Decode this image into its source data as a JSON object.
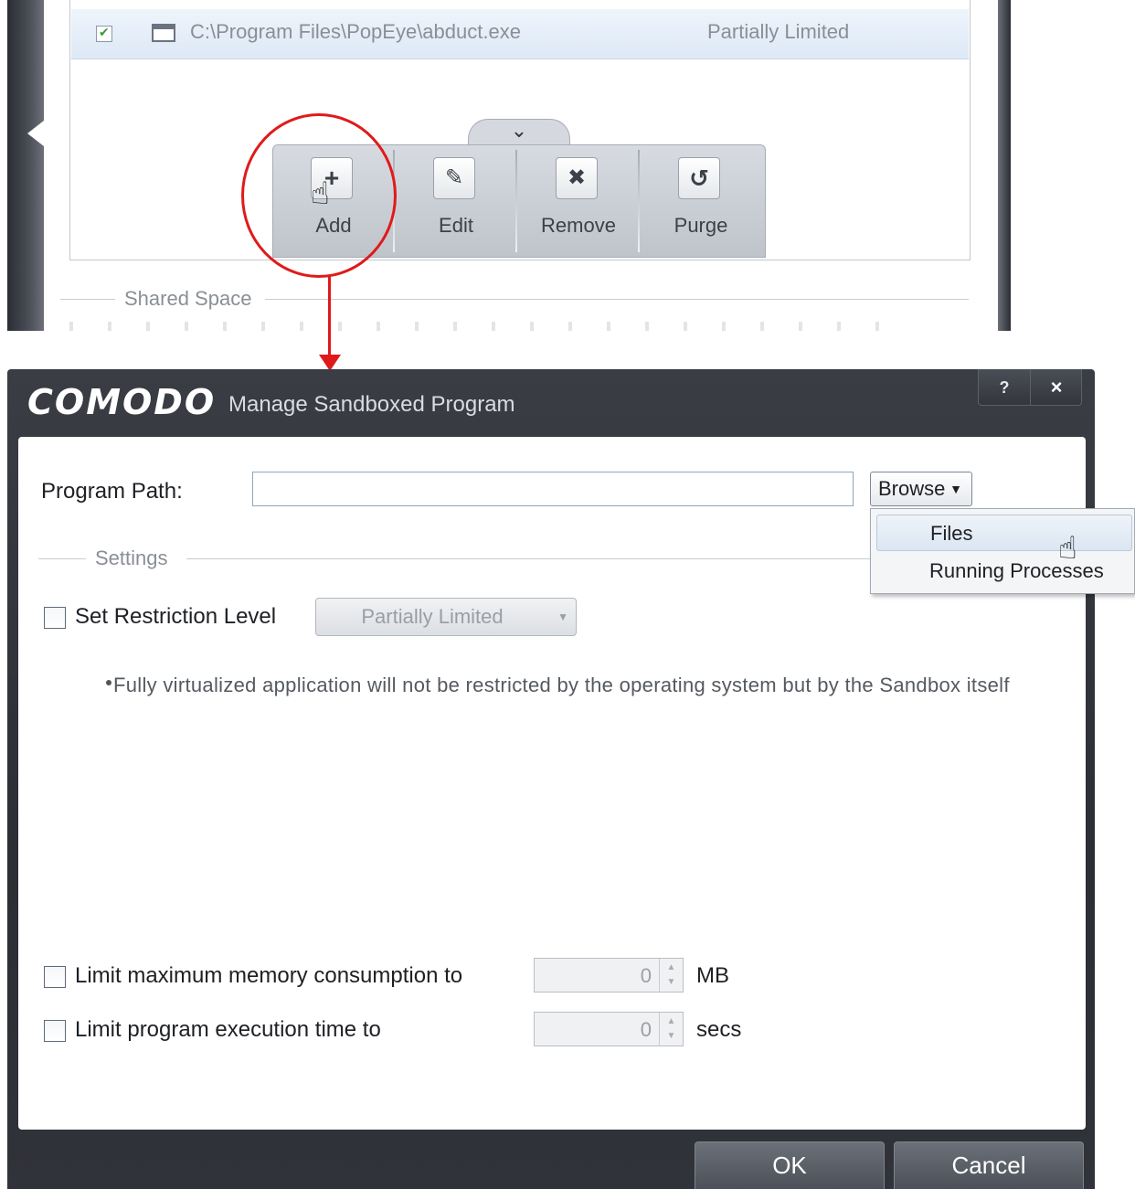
{
  "list": {
    "row": {
      "checked": true,
      "path": "C:\\Program Files\\PopEye\\abduct.exe",
      "level": "Partially Limited"
    }
  },
  "toolbar": {
    "buttons": [
      {
        "label": "Add",
        "icon": "plus-icon",
        "glyph": "+"
      },
      {
        "label": "Edit",
        "icon": "pencil-icon",
        "glyph": "✎"
      },
      {
        "label": "Remove",
        "icon": "x-icon",
        "glyph": "✖"
      },
      {
        "label": "Purge",
        "icon": "refresh-icon",
        "glyph": "↺"
      }
    ]
  },
  "shared_space": {
    "label": "Shared Space"
  },
  "dialog": {
    "brand": "COMODO",
    "title": "Manage Sandboxed Program",
    "help_label": "?",
    "close_label": "×",
    "program_path": {
      "label": "Program Path:",
      "value": ""
    },
    "browse": {
      "label": "Browse",
      "menu": [
        "Files",
        "Running Processes"
      ],
      "highlighted": "Files"
    },
    "settings_label": "Settings",
    "restriction": {
      "label": "Set Restriction Level",
      "checked": false,
      "value": "Partially Limited"
    },
    "note": "Fully virtualized application will not be restricted by the operating system but by the Sandbox itself",
    "memory": {
      "label": "Limit maximum memory consumption to",
      "checked": false,
      "value": "0",
      "unit": "MB"
    },
    "exec_time": {
      "label": "Limit program execution time to",
      "checked": false,
      "value": "0",
      "unit": "secs"
    },
    "ok_label": "OK",
    "cancel_label": "Cancel"
  },
  "colors": {
    "callout": "#e01a1a",
    "dialog_bg": "#2b2e34",
    "row_highlight": "#dde9f6"
  }
}
